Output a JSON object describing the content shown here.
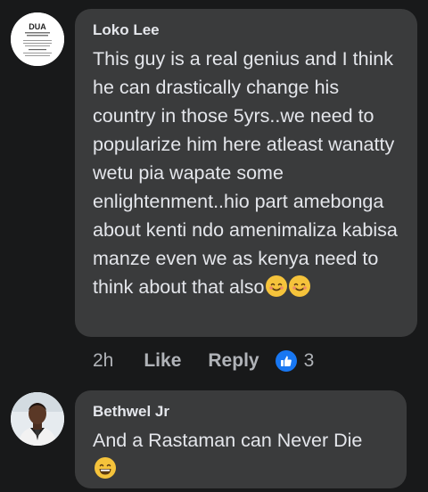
{
  "comments": [
    {
      "author": "Loko Lee",
      "avatar_text": "DUA",
      "text": "This guy is a real genius and I think he can drastically change his country in those 5yrs..we need to popularize him here atleast wanatty wetu pia wapate some enlightenment..hio part amebonga about kenti ndo amenimaliza kabisa manze even we as kenya need to think about that also",
      "emojis": [
        "smiling-face-icon",
        "smiling-face-icon"
      ],
      "time": "2h",
      "like_label": "Like",
      "reply_label": "Reply",
      "reaction_count": "3",
      "reaction_icon": "thumbs-up-icon"
    },
    {
      "author": "Bethwel Jr",
      "text": "And a Rastaman can Never Die",
      "emojis": [
        "grinning-face-icon"
      ]
    }
  ],
  "colors": {
    "background": "#18191a",
    "bubble": "#3a3b3c",
    "text": "#e4e6eb",
    "secondary_text": "#b0b3b8",
    "like_blue": "#1877f2"
  }
}
